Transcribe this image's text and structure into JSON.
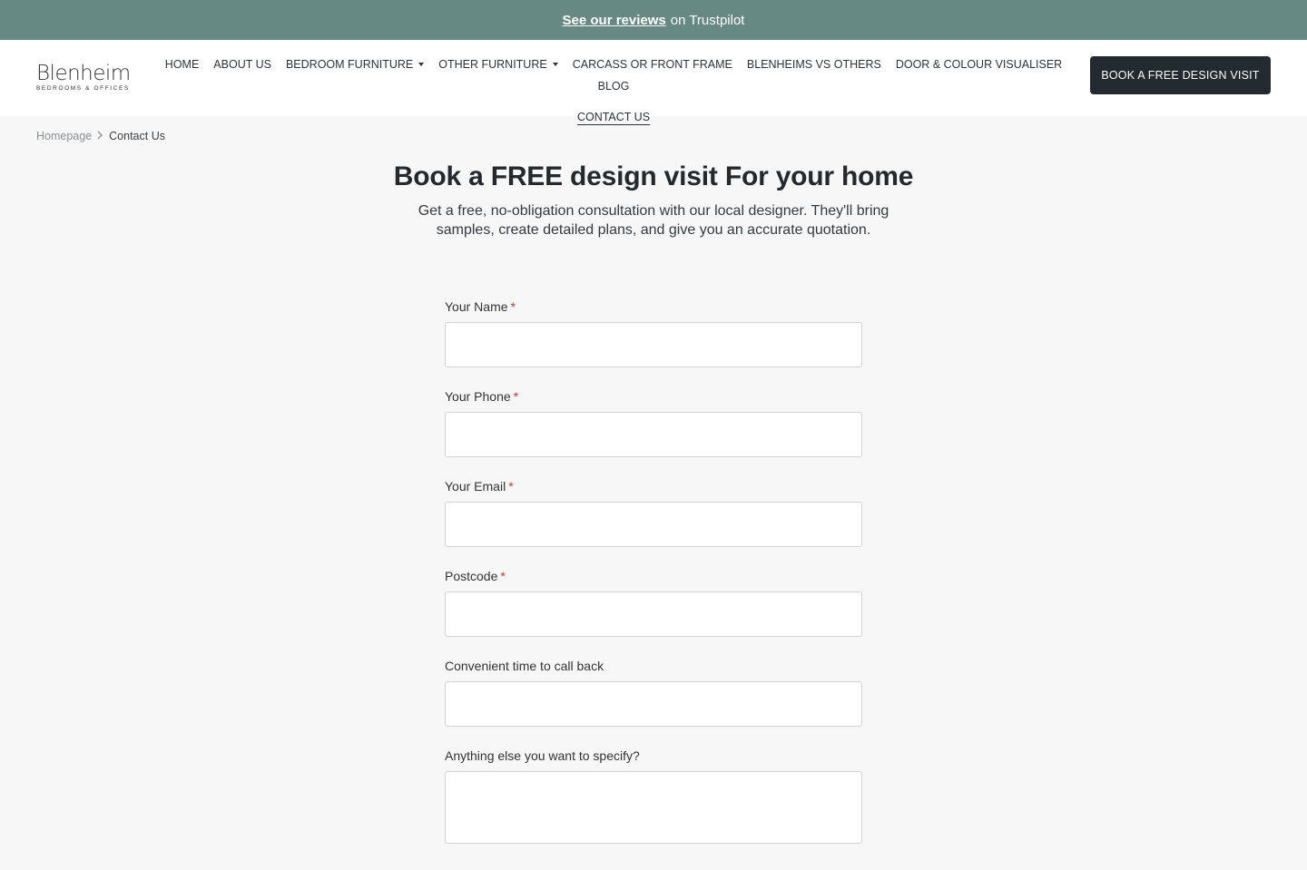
{
  "topbar": {
    "link_text": "See our reviews",
    "suffix_text": "on Trustpilot"
  },
  "logo": {
    "main": "Blenheim",
    "sub": "BEDROOMS & OFFICES"
  },
  "nav": {
    "items": [
      {
        "label": "HOME",
        "dropdown": false
      },
      {
        "label": "ABOUT US",
        "dropdown": false
      },
      {
        "label": "BEDROOM FURNITURE",
        "dropdown": true
      },
      {
        "label": "OTHER FURNITURE",
        "dropdown": true
      },
      {
        "label": "CARCASS OR FRONT FRAME",
        "dropdown": false
      },
      {
        "label": "BLENHEIMS VS OTHERS",
        "dropdown": false
      },
      {
        "label": "DOOR & COLOUR VISUALISER",
        "dropdown": false
      },
      {
        "label": "BLOG",
        "dropdown": false
      },
      {
        "label": "CONTACT US",
        "dropdown": false,
        "active": true
      }
    ]
  },
  "cta_label": "BOOK A FREE DESIGN VISIT",
  "breadcrumb": {
    "home": "Homepage",
    "current": "Contact Us"
  },
  "hero": {
    "title": "Book a FREE design visit For your home",
    "subtitle": "Get a free, no-obligation consultation with our local designer. They'll bring samples, create detailed plans, and give you an accurate quotation."
  },
  "form": {
    "fields": [
      {
        "label": "Your Name",
        "required": true,
        "value": ""
      },
      {
        "label": "Your Phone",
        "required": true,
        "value": ""
      },
      {
        "label": "Your Email",
        "required": true,
        "value": ""
      },
      {
        "label": "Postcode",
        "required": true,
        "value": ""
      },
      {
        "label": "Convenient time to call back",
        "required": false,
        "value": ""
      },
      {
        "label": "Anything else you want to specify?",
        "required": false,
        "value": ""
      }
    ],
    "required_marker": "*"
  },
  "colors": {
    "topbar_bg": "#668a83",
    "cta_bg": "#232a30",
    "required": "#dd3333",
    "page_bg": "#f7f7f7"
  }
}
